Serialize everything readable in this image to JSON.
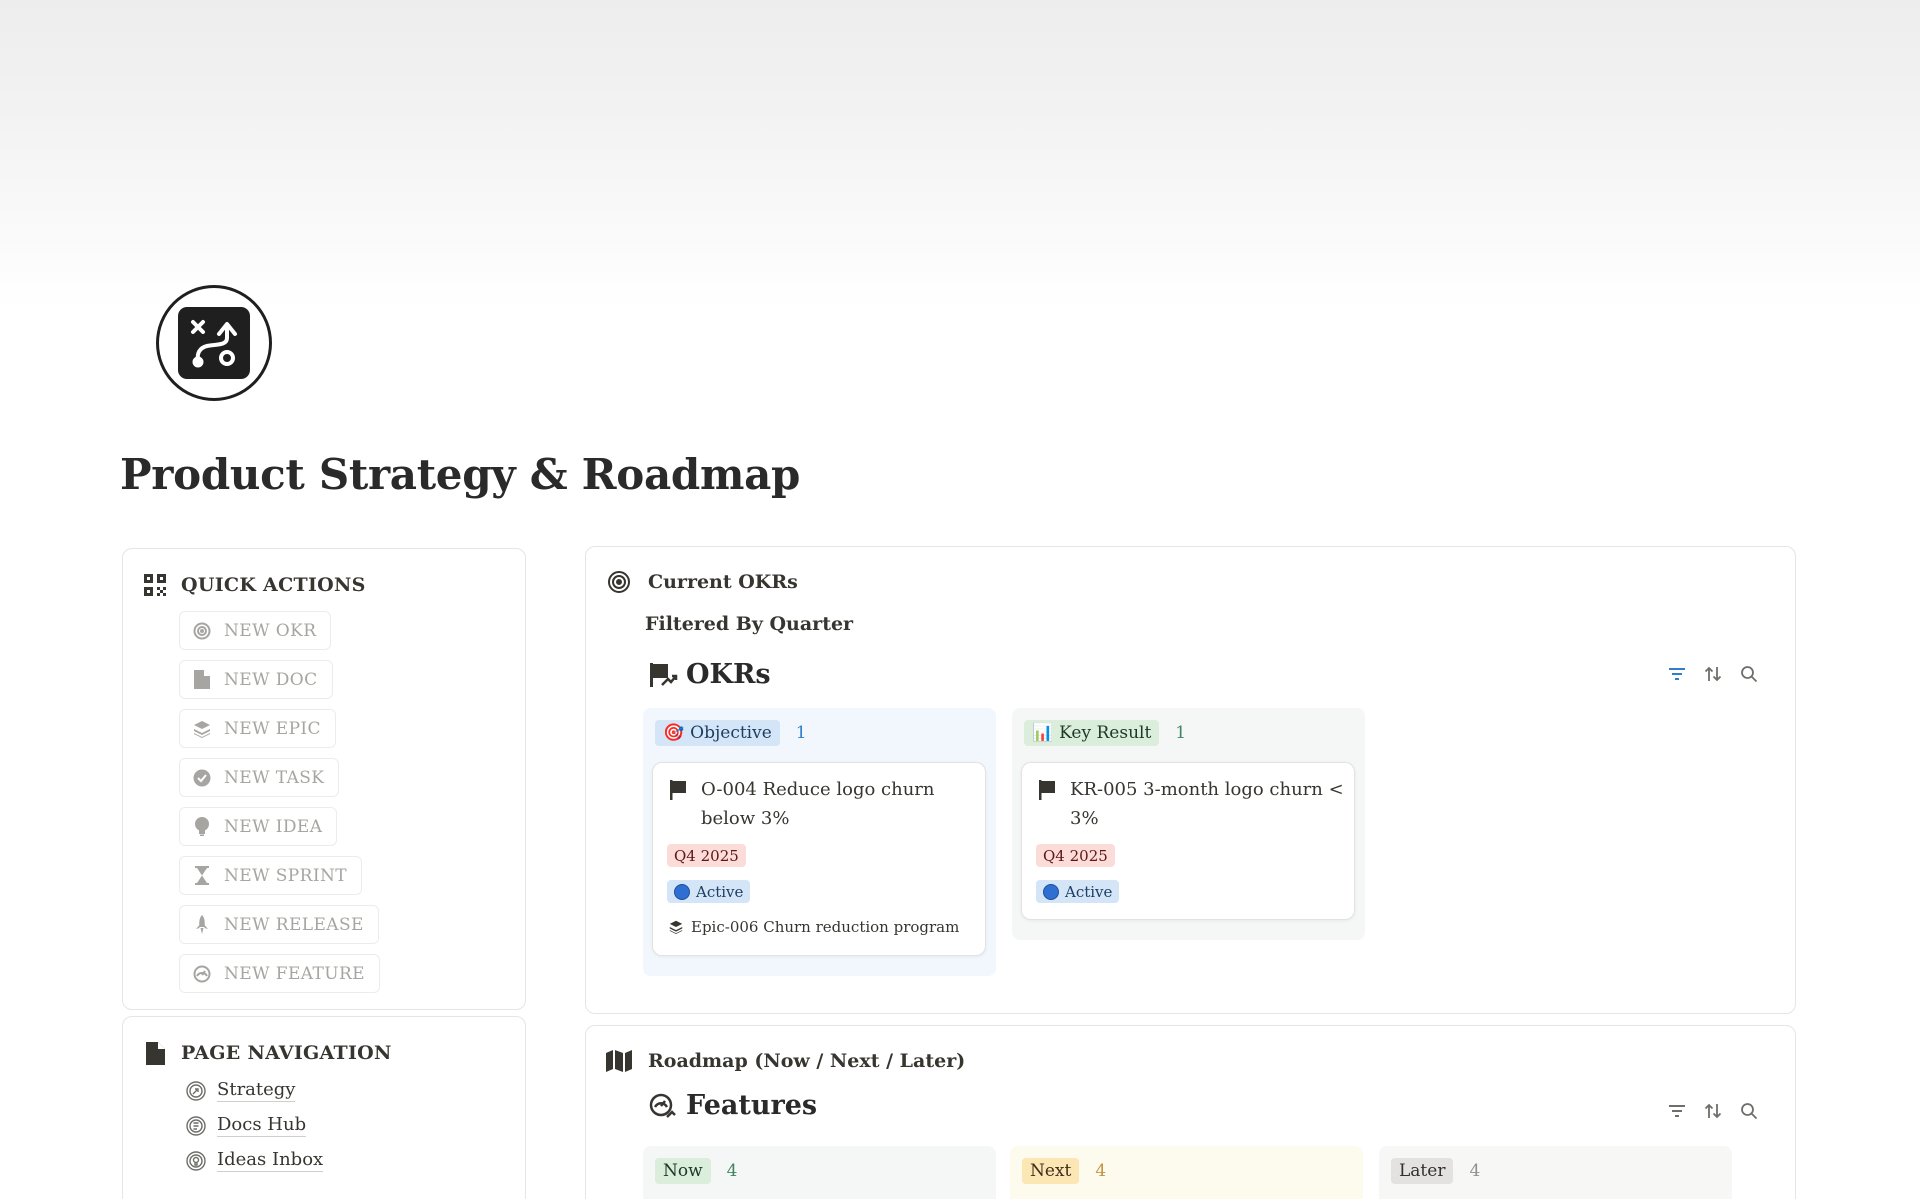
{
  "page": {
    "title": "Product Strategy & Roadmap",
    "icon": "roadmap-route-icon"
  },
  "quick_actions": {
    "title": "QUICK ACTIONS",
    "icon": "qr-grid-icon",
    "items": [
      {
        "label": "NEW OKR",
        "icon": "target-icon"
      },
      {
        "label": "NEW DOC",
        "icon": "document-icon"
      },
      {
        "label": "NEW EPIC",
        "icon": "layers-icon"
      },
      {
        "label": "NEW TASK",
        "icon": "check-badge-icon"
      },
      {
        "label": "NEW IDEA",
        "icon": "lightbulb-icon"
      },
      {
        "label": "NEW SPRINT",
        "icon": "hourglass-icon"
      },
      {
        "label": "NEW RELEASE",
        "icon": "rocket-icon"
      },
      {
        "label": "NEW FEATURE",
        "icon": "feature-gauge-icon"
      }
    ]
  },
  "page_navigation": {
    "title": "PAGE NAVIGATION",
    "icon": "document-icon",
    "items": [
      {
        "label": "Strategy",
        "icon": "strategy-icon"
      },
      {
        "label": "Docs Hub",
        "icon": "docs-icon"
      },
      {
        "label": "Ideas Inbox",
        "icon": "idea-icon"
      }
    ]
  },
  "okrs_section": {
    "heading": "Current OKRs",
    "subheading": "Filtered By Quarter",
    "db_title": "OKRs",
    "columns": [
      {
        "tag": "Objective",
        "tag_emoji": "🎯",
        "count": "1",
        "cards": [
          {
            "title_line1": "O-004 Reduce logo churn",
            "title_line2": "below 3%",
            "quarter": "Q4 2025",
            "status": "Active",
            "relation": "Epic-006 Churn reduction program"
          }
        ]
      },
      {
        "tag": "Key Result",
        "tag_emoji": "📊",
        "count": "1",
        "cards": [
          {
            "title_line1": "KR-005 3-month logo churn <",
            "title_line2": "3%",
            "quarter": "Q4 2025",
            "status": "Active"
          }
        ]
      }
    ]
  },
  "roadmap_section": {
    "heading": "Roadmap (Now / Next / Later)",
    "db_title": "Features",
    "columns": [
      {
        "tag": "Now",
        "count": "4"
      },
      {
        "tag": "Next",
        "count": "4"
      },
      {
        "tag": "Later",
        "count": "4"
      }
    ]
  },
  "colors": {
    "objective_bg": "#f1f7fc",
    "objective_tag": "#d3e5f7",
    "keyresult_bg": "#f5f7f6",
    "keyresult_tag": "#dbeddb",
    "now_tag": "#dbeddb",
    "next_tag": "#fbe6b4",
    "later_tag": "#e3e2e0",
    "quarter_pill": "#fcdcd9",
    "active_pill": "#d3e5f7"
  }
}
